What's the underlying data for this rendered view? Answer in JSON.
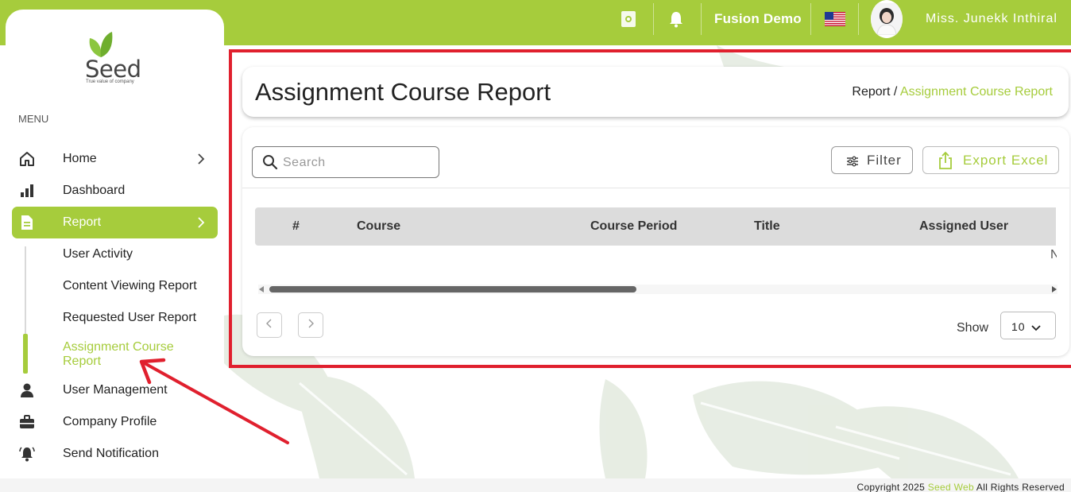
{
  "header": {
    "company": "Fusion Demo",
    "user_name": "Miss. Junekk Inthiral",
    "icons": [
      "document-icon",
      "bell-icon",
      "us-flag-icon",
      "avatar"
    ]
  },
  "logo": {
    "word": "Seed",
    "tagline": "True value of company"
  },
  "sidebar": {
    "menu_label": "MENU",
    "items": [
      {
        "label": "Home",
        "icon": "home-icon",
        "has_chevron": true
      },
      {
        "label": "Dashboard",
        "icon": "bar-chart-icon",
        "has_chevron": false
      },
      {
        "label": "Report",
        "icon": "document-icon",
        "has_chevron": true,
        "active": true
      },
      {
        "label": "User Management",
        "icon": "user-icon",
        "has_chevron": false
      },
      {
        "label": "Company Profile",
        "icon": "briefcase-icon",
        "has_chevron": false
      },
      {
        "label": "Send Notification",
        "icon": "bell-ring-icon",
        "has_chevron": false
      }
    ],
    "report_sub": [
      {
        "label": "User Activity"
      },
      {
        "label": "Content Viewing Report"
      },
      {
        "label": "Requested User Report"
      },
      {
        "label": "Assignment Course Report",
        "active": true
      }
    ]
  },
  "page": {
    "title": "Assignment Course Report",
    "breadcrumb": {
      "parent": "Report",
      "separator": " / ",
      "current": "Assignment Course Report"
    }
  },
  "toolbar": {
    "search_placeholder": "Search",
    "search_value": "",
    "filter_label": "Filter",
    "export_label": "Export Excel"
  },
  "table": {
    "columns": [
      "#",
      "Course",
      "Course Period",
      "Title",
      "Assigned User"
    ],
    "rows": [],
    "empty_text_partial": "N"
  },
  "pagination": {
    "show_label": "Show",
    "page_size": "10"
  },
  "footer": {
    "prefix": "Copyright 2025",
    "brand": "Seed Web",
    "suffix": "All Rights Reserved"
  },
  "colors": {
    "accent": "#a6cc3c",
    "annotation_red": "#e0202e",
    "table_header": "#dcdcdc"
  }
}
